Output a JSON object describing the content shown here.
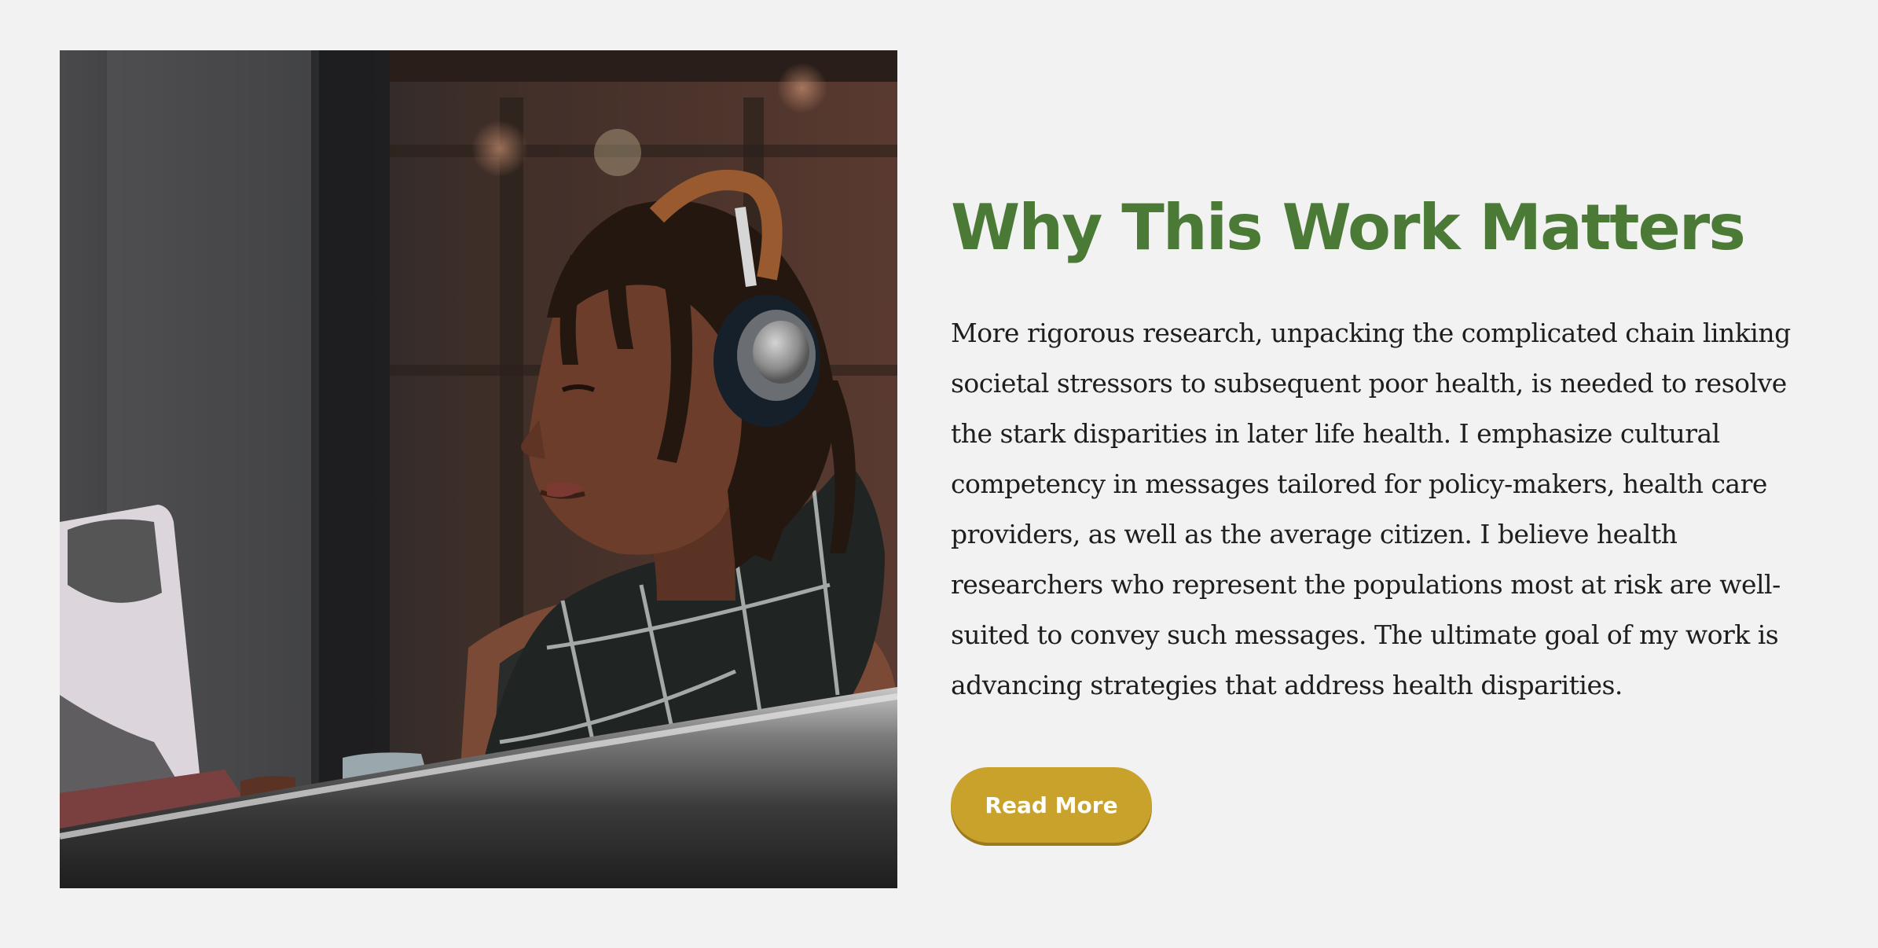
{
  "section": {
    "title": "Why This Work Matters",
    "body": "More rigorous research, unpacking the complicated chain linking societal stressors to subsequent poor health, is needed to resolve the stark disparities in later life health. I emphasize cultural competency in messages tailored for policy-makers, health care providers, as well as the average citizen. I believe health researchers who represent the populations most at risk are well-suited to convey such messages. The ultimate goal of my work is advancing strategies that address health disparities.",
    "button_label": "Read More"
  },
  "colors": {
    "background": "#f2f2f2",
    "title": "#4a7a36",
    "button": "#c9a22c",
    "button_text": "#ffffff",
    "body_text": "#1e1e1e"
  },
  "image": {
    "icon": "photo-woman-headphones-laptop"
  }
}
